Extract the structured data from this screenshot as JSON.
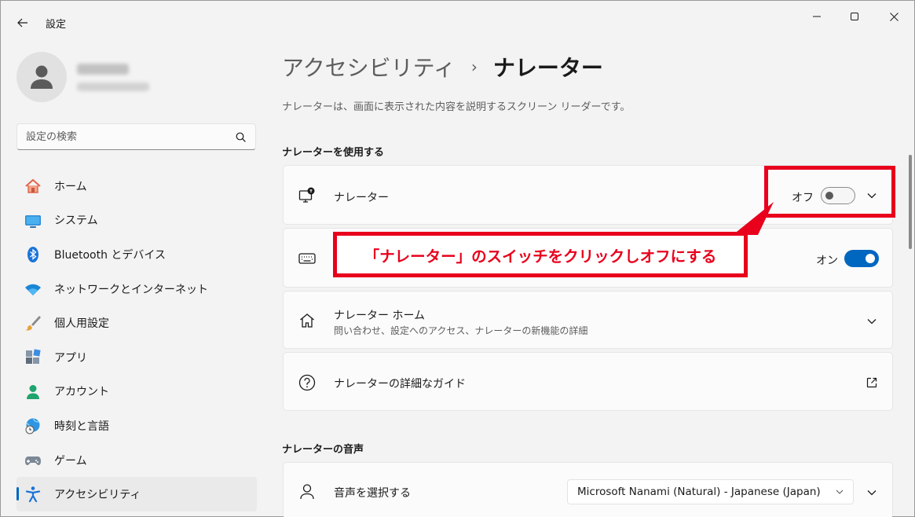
{
  "titlebar": {
    "app_title": "設定"
  },
  "user": {
    "avatar_icon": "person-icon"
  },
  "search": {
    "placeholder": "設定の検索"
  },
  "sidebar": {
    "items": [
      {
        "label": "ホーム",
        "icon": "home-icon"
      },
      {
        "label": "システム",
        "icon": "monitor-icon"
      },
      {
        "label": "Bluetooth とデバイス",
        "icon": "bluetooth-icon"
      },
      {
        "label": "ネットワークとインターネット",
        "icon": "wifi-icon"
      },
      {
        "label": "個人用設定",
        "icon": "brush-icon"
      },
      {
        "label": "アプリ",
        "icon": "apps-icon"
      },
      {
        "label": "アカウント",
        "icon": "account-icon"
      },
      {
        "label": "時刻と言語",
        "icon": "globe-clock-icon"
      },
      {
        "label": "ゲーム",
        "icon": "gamepad-icon"
      },
      {
        "label": "アクセシビリティ",
        "icon": "accessibility-icon",
        "active": true
      }
    ]
  },
  "main": {
    "breadcrumb_parent": "アクセシビリティ",
    "breadcrumb_sep": "›",
    "breadcrumb_current": "ナレーター",
    "description": "ナレーターは、画面に表示された内容を説明するスクリーン リーダーです。",
    "section_use": "ナレーターを使用する",
    "narrator_row": {
      "title": "ナレーター",
      "toggle_label": "オフ",
      "state": "off"
    },
    "shortcut_row": {
      "toggle_label": "オン",
      "state": "on"
    },
    "home_row": {
      "title": "ナレーター ホーム",
      "subtitle": "問い合わせ、設定へのアクセス、ナレーターの新機能の詳細"
    },
    "guide_row": {
      "title": "ナレーターの詳細なガイド"
    },
    "section_voice": "ナレーターの音声",
    "voice_row": {
      "title": "音声を選択する",
      "selected": "Microsoft Nanami (Natural) - Japanese (Japan)"
    }
  },
  "annotation": {
    "text": "「ナレーター」のスイッチをクリックしオフにする",
    "color": "#e8001c"
  },
  "colors": {
    "accent": "#0067c0"
  }
}
